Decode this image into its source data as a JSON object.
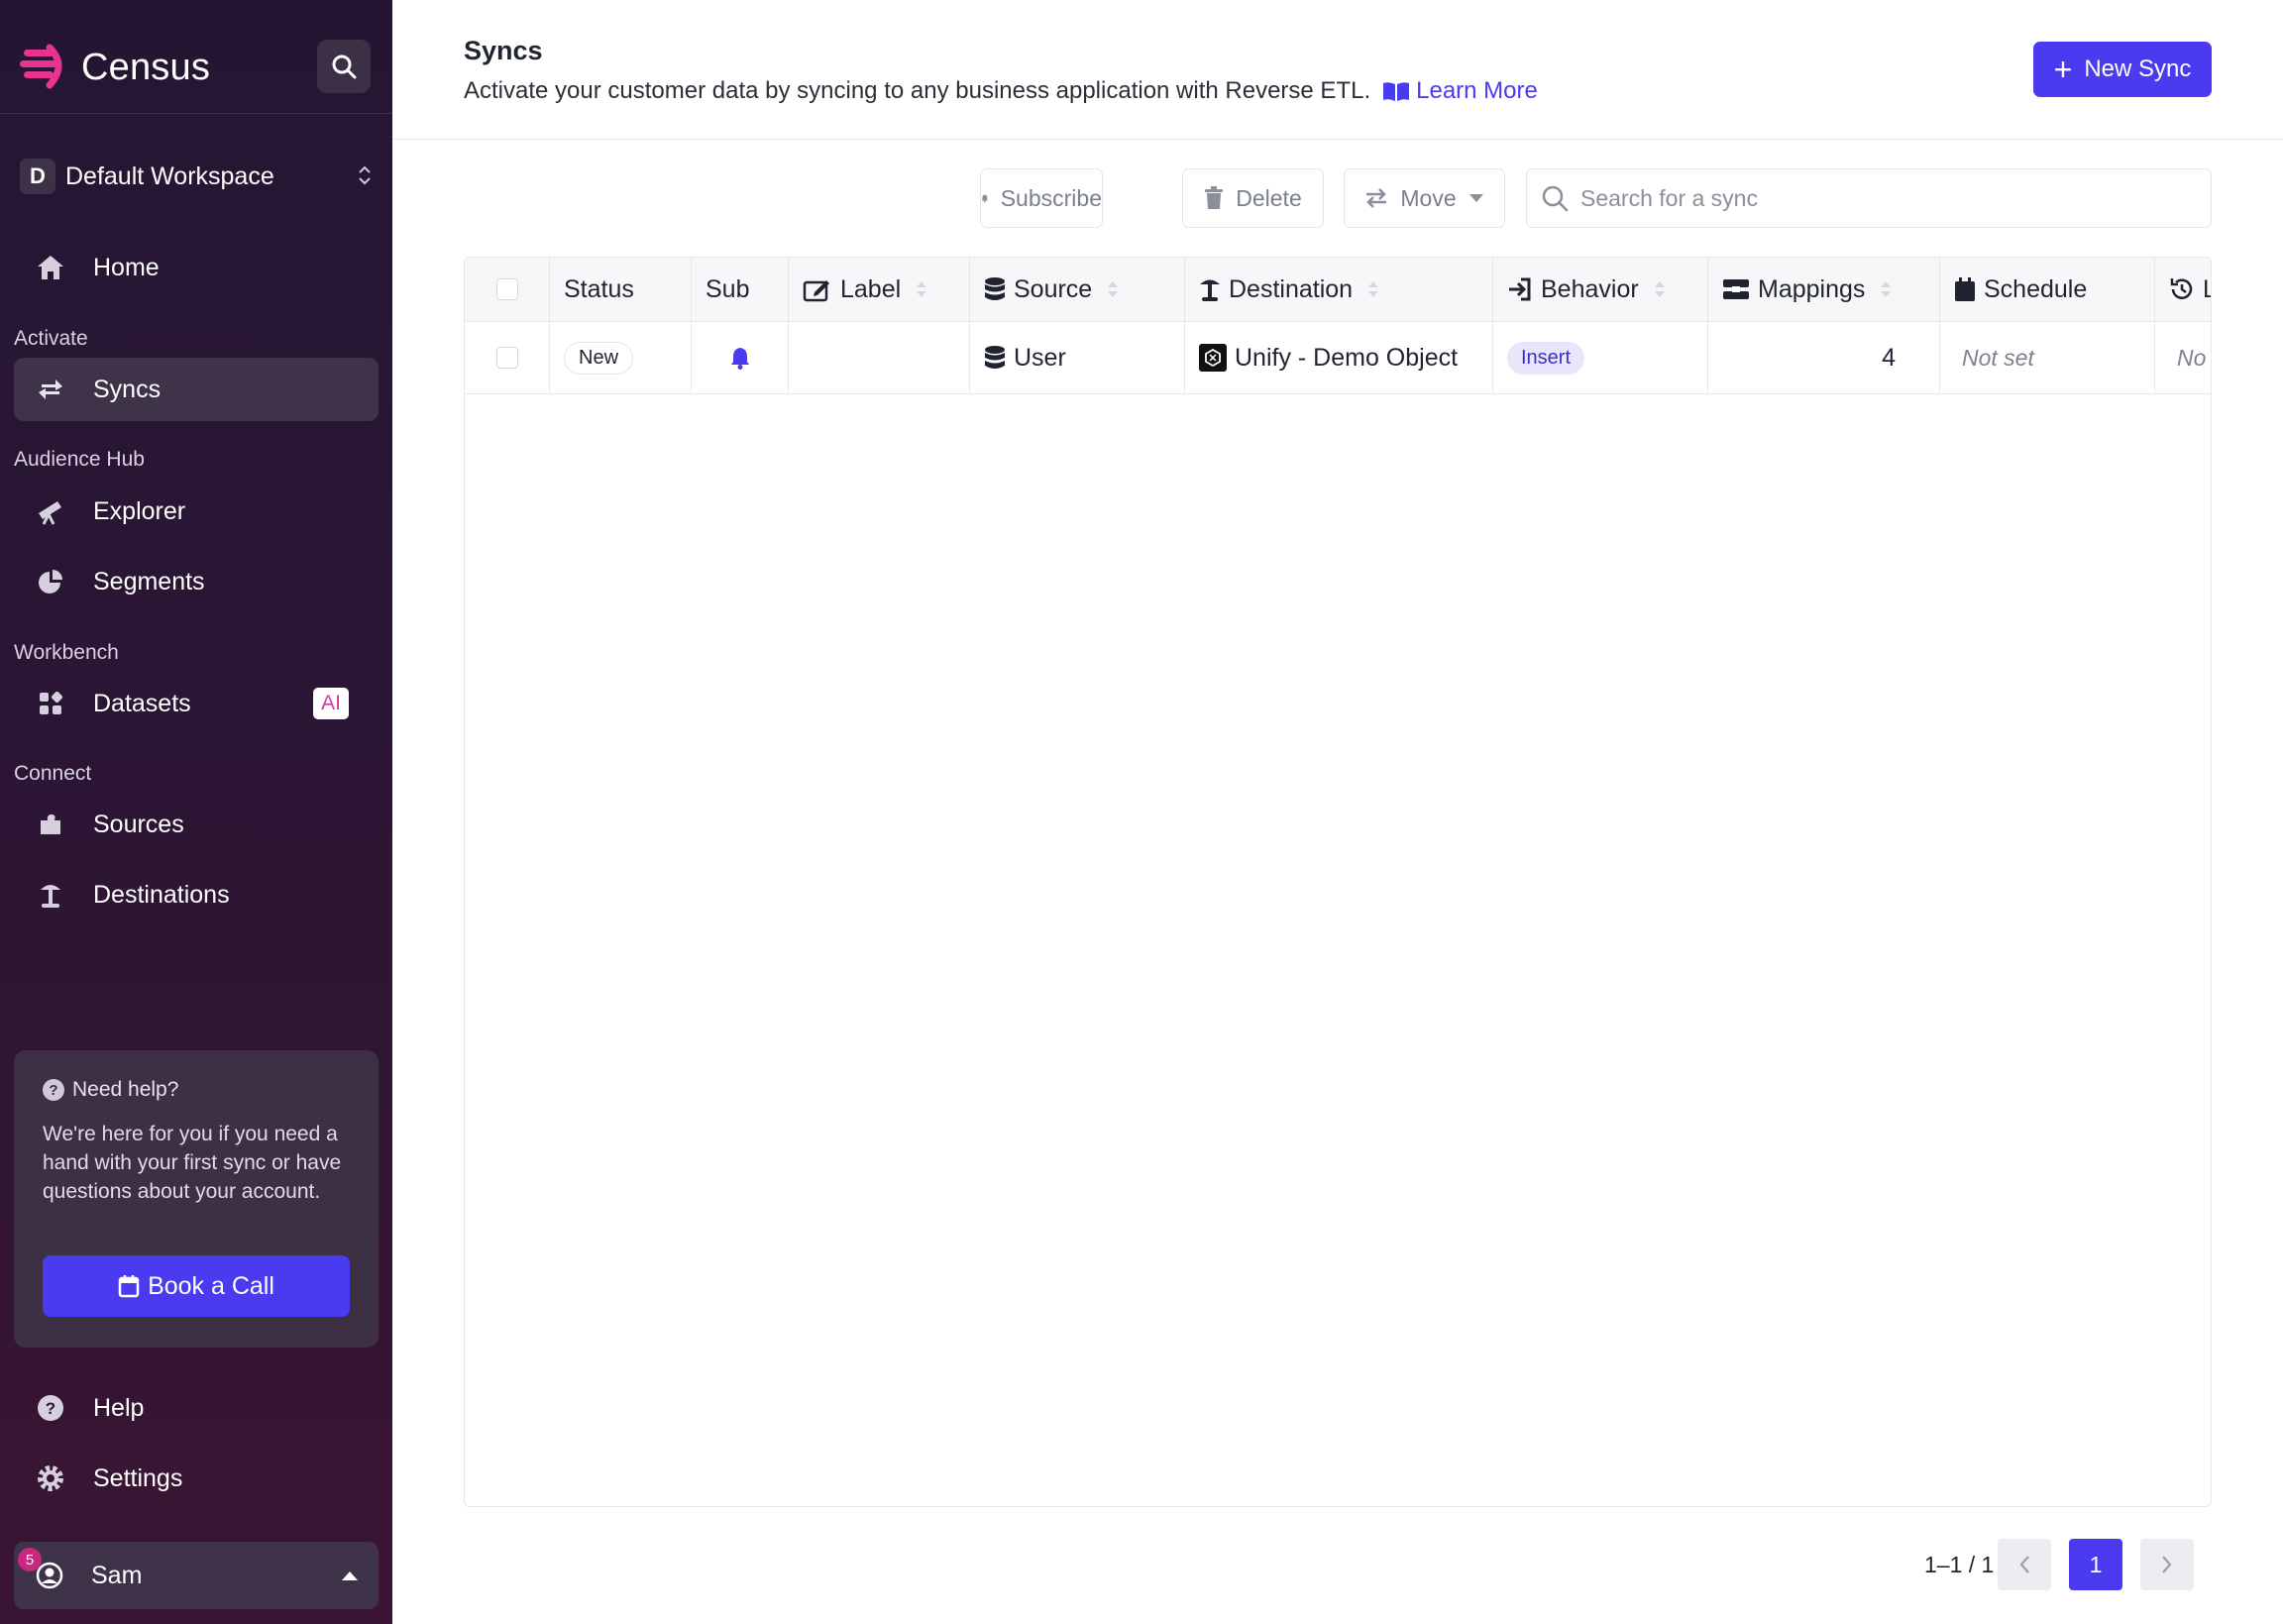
{
  "app": {
    "name": "Census"
  },
  "sidebar": {
    "workspace": {
      "initial": "D",
      "name": "Default Workspace"
    },
    "home": "Home",
    "sections": {
      "activate": "Activate",
      "audience_hub": "Audience Hub",
      "workbench": "Workbench",
      "connect": "Connect"
    },
    "items": {
      "syncs": "Syncs",
      "explorer": "Explorer",
      "segments": "Segments",
      "datasets": "Datasets",
      "datasets_badge": "AI",
      "sources": "Sources",
      "destinations": "Destinations",
      "help": "Help",
      "settings": "Settings"
    },
    "help_card": {
      "title": "Need help?",
      "text": "We're here for you if you need a hand with your first sync or have questions about your account.",
      "button": "Book a Call"
    },
    "user": {
      "name": "Sam",
      "notifications": "5"
    }
  },
  "page": {
    "title": "Syncs",
    "description": "Activate your customer data by syncing to any business application with Reverse ETL.",
    "learn_more": "Learn More",
    "new_sync": "New Sync"
  },
  "toolbar": {
    "subscribe": "Subscribe",
    "delete": "Delete",
    "move": "Move",
    "search_placeholder": "Search for a sync"
  },
  "table": {
    "columns": {
      "status": "Status",
      "sub": "Sub",
      "label": "Label",
      "source": "Source",
      "destination": "Destination",
      "behavior": "Behavior",
      "mappings": "Mappings",
      "schedule": "Schedule",
      "last": "L"
    },
    "rows": [
      {
        "status": "New",
        "subscribed": true,
        "label": "",
        "source": "User",
        "destination": "Unify - Demo Object",
        "behavior": "Insert",
        "mappings": "4",
        "schedule": "Not set",
        "last": "No"
      }
    ]
  },
  "pagination": {
    "range": "1–1 / 1",
    "current": "1"
  },
  "colors": {
    "accent": "#4a3af0",
    "sidebar": "#2b1534",
    "brand_pink": "#e8338f"
  }
}
